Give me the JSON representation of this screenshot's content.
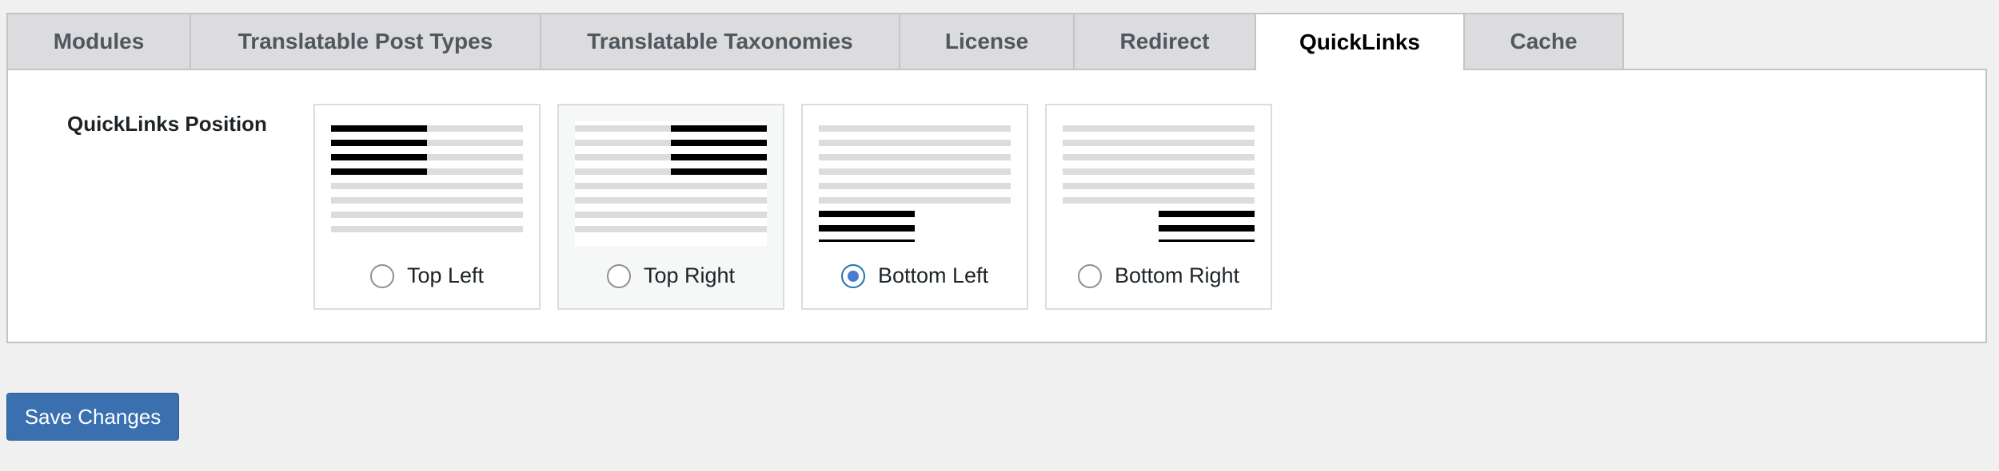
{
  "tabs": [
    {
      "label": "Modules"
    },
    {
      "label": "Translatable Post Types"
    },
    {
      "label": "Translatable Taxonomies"
    },
    {
      "label": "License"
    },
    {
      "label": "Redirect"
    },
    {
      "label": "QuickLinks"
    },
    {
      "label": "Cache"
    }
  ],
  "active_tab": "QuickLinks",
  "setting": {
    "label": "QuickLinks Position",
    "options": [
      {
        "label": "Top Left",
        "checked": false
      },
      {
        "label": "Top Right",
        "checked": false
      },
      {
        "label": "Bottom Left",
        "checked": true
      },
      {
        "label": "Bottom Right",
        "checked": false
      }
    ]
  },
  "save_button": {
    "label": "Save Changes"
  },
  "colors": {
    "accent": "#2271b1",
    "button": "#3a6fb0",
    "tab_inactive": "#dcdcde",
    "background": "#f0f0f1"
  }
}
